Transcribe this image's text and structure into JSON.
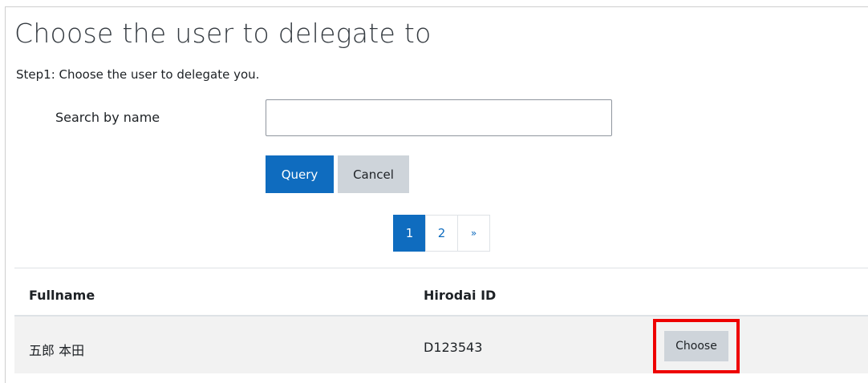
{
  "page": {
    "title": "Choose the user to delegate to",
    "step_text": "Step1: Choose the user to delegate you."
  },
  "search": {
    "label": "Search by name",
    "value": "",
    "placeholder": ""
  },
  "buttons": {
    "query": "Query",
    "cancel": "Cancel"
  },
  "pagination": {
    "pages": [
      "1",
      "2"
    ],
    "current": "1",
    "next": "»"
  },
  "table": {
    "headers": [
      "Fullname",
      "Hirodai ID",
      ""
    ],
    "rows": [
      {
        "fullname": "五郎 本田",
        "hirodai_id": "D123543",
        "action": "Choose"
      }
    ]
  },
  "colors": {
    "primary": "#0f6cbf",
    "secondary": "#ced4da",
    "highlight": "#ee0000"
  }
}
